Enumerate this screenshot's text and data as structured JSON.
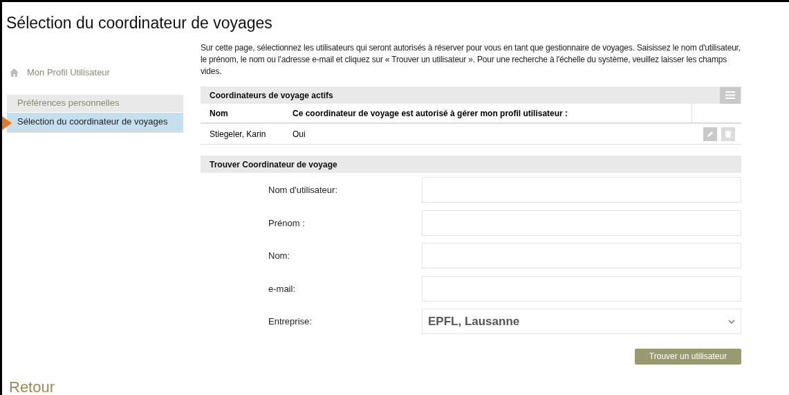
{
  "title": "Sélection du coordinateur de voyages",
  "sidebar": {
    "heading": "Mon Profil Utilisateur",
    "items": [
      {
        "label": "Préférences personnelles",
        "selected": false
      },
      {
        "label": "Sélection du coordinateur de voyages",
        "selected": true
      }
    ]
  },
  "intro": "Sur cette page, sélectionnez les utilisateurs qui seront autorisés à réserver pour vous en tant que gestionnaire de voyages. Saisissez le nom d'utilisateur, le prénom, le nom ou l’adresse e-mail et cliquez sur « Trouver un utilisateur ». Pour une recherche à l'échelle du système, veuillez laisser les champs vides.",
  "active_table": {
    "title": "Coordinateurs de voyage actifs",
    "columns": [
      "Nom",
      "Ce coordinateur de voyage est autorisé à gérer mon profil utilisateur :"
    ],
    "rows": [
      [
        "Stiegeler, Karin",
        "Oui"
      ]
    ]
  },
  "search": {
    "title": "Trouver Coordinateur de voyage",
    "fields": [
      {
        "kind": "text",
        "label": "Nom d'utilisateur:"
      },
      {
        "kind": "text",
        "label": "Prénom :"
      },
      {
        "kind": "text",
        "label": "Nom:"
      },
      {
        "kind": "text",
        "label": "e-mail:"
      },
      {
        "kind": "select",
        "label": "Entreprise:",
        "value": "EPFL, Lausanne"
      }
    ],
    "button": "Trouver un utilisateur"
  },
  "back_link": "Retour"
}
